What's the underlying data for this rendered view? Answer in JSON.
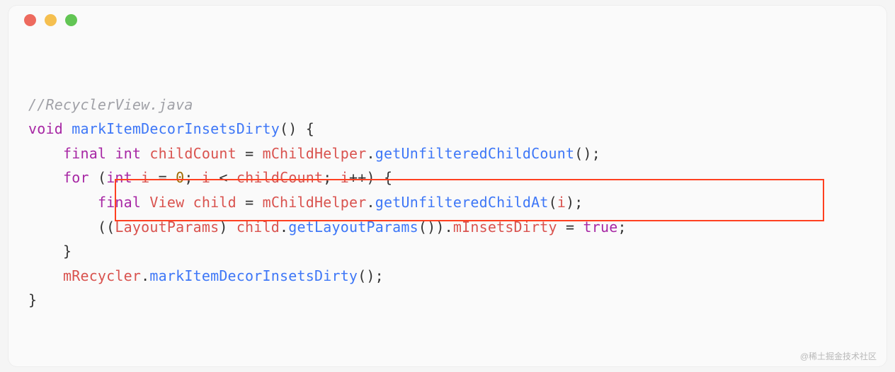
{
  "window": {
    "controls": [
      "close",
      "minimize",
      "zoom"
    ]
  },
  "code": {
    "comment": "//RecyclerView.java",
    "line2": {
      "kw_void": "void",
      "fn": "markItemDecorInsetsDirty",
      "tail": "() {"
    },
    "line3": {
      "kw_final": "final",
      "kw_int": "int",
      "var": "childCount",
      "eq": " = ",
      "obj": "mChildHelper",
      "dot": ".",
      "call": "getUnfilteredChildCount",
      "tail": "();"
    },
    "line4": {
      "kw_for": "for",
      "open": " (",
      "kw_int": "int",
      "sp": " ",
      "var_i": "i",
      "eq": " = ",
      "zero": "0",
      "semi1": "; ",
      "var_i2": "i",
      "lt": " < ",
      "cc": "childCount",
      "semi2": "; ",
      "var_i3": "i",
      "inc": "++",
      "close": ") {"
    },
    "line5": {
      "kw_final": "final",
      "type": "View",
      "sp": " ",
      "var": "child",
      "eq": " = ",
      "obj": "mChildHelper",
      "dot": ".",
      "call": "getUnfilteredChildAt",
      "open": "(",
      "arg": "i",
      "close": ");"
    },
    "line6": {
      "open": "((",
      "type": "LayoutParams",
      "close1": ") ",
      "obj": "child",
      "dot1": ".",
      "call": "getLayoutParams",
      "close2": "()).",
      "field": "mInsetsDirty",
      "eq": " = ",
      "val": "true",
      "semi": ";"
    },
    "line7": {
      "brace": "}"
    },
    "line8": {
      "obj": "mRecycler",
      "dot": ".",
      "call": "markItemDecorInsetsDirty",
      "tail": "();"
    },
    "line9": {
      "brace": "}"
    }
  },
  "highlight": {
    "note": "red box around line6 extending up to partly cover line5"
  },
  "watermark": "@稀土掘金技术社区"
}
